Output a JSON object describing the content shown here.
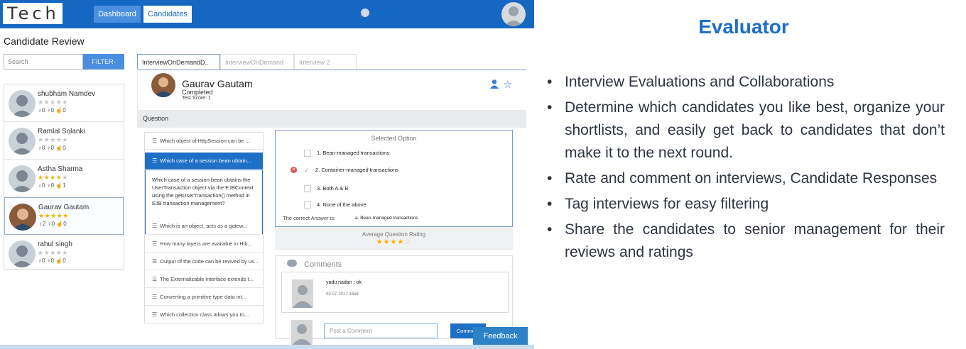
{
  "app": {
    "logo": "Tech",
    "nav": {
      "dashboard": "Dashboard",
      "candidates": "Candidates"
    },
    "page_title": "Candidate Review",
    "search": {
      "placeholder": "Search",
      "filter": "FILTER-"
    },
    "candidates": [
      {
        "name": "shubham Namdev",
        "rating": 0,
        "stats": "♁0  ♀0  ☝0"
      },
      {
        "name": "Ramlal Solanki",
        "rating": 0,
        "stats": "♁0  ♀0  ☝0"
      },
      {
        "name": "Astha Sharma",
        "rating": 4,
        "stats": "♁0  ♀0  ☝1"
      },
      {
        "name": "Gaurav Gautam",
        "rating": 5,
        "stats": "♁2  ♀0  ☝0"
      },
      {
        "name": "rahul singh",
        "rating": 0,
        "stats": "♁0  ♀0  ☝0"
      }
    ],
    "interview_tabs": [
      "InterviewOnDemandD..",
      "InterviewOnDemand",
      "Interview 2"
    ],
    "selected_candidate": {
      "name": "Gaurav Gautam",
      "status": "Completed",
      "score": "Test Score: 1"
    },
    "question_header": "Question",
    "questions": [
      "Which object of HttpSession can be ...",
      "Which case of a session bean obtain...",
      "Which is an object, acts as a gatew...",
      "How many layers are available in Hib...",
      "Output of the code can be revived by us...",
      "The Externalizable interface extends t...",
      "Converting a primitive type data int...",
      "Which collection class allows you to..."
    ],
    "question_detail": "Which case of a session bean obtains the UserTransaction object via the EJBContext using the getUserTransaction() method in EJB transaction management?",
    "selected_option_title": "Selected Option",
    "answers": [
      "1. Bean-managed transactions",
      "2. Container-managed transactions",
      "3. Both A & B",
      "4. None of the above"
    ],
    "correct_label": "The correct Answer is:",
    "correct_value": "a. Bean-managed transactions",
    "avg_rating_label": "Average Question Rating",
    "avg_rating": 4,
    "comments_title": "Comments",
    "comment": {
      "user": "yadu nadan : ok",
      "date": "03-07-2017 1658"
    },
    "post_placeholder": "Post a Comment",
    "post_button": "Comment",
    "feedback": "Feedback"
  },
  "panel": {
    "title": "Evaluator",
    "bullets": [
      "Interview Evaluations and Collaborations",
      "Determine which candidates you like best, organize your shortlists, and easily get back to candidates that don’t make it to the next round.",
      "Rate and comment on interviews, Candidate Responses",
      "Tag interviews for easy filtering",
      "Share the candidates to senior management for their reviews and ratings"
    ]
  },
  "colors": {
    "brand": "#1667c2",
    "accent": "#1f6fc7",
    "star": "#f2b200",
    "wrong": "#d9534f"
  }
}
